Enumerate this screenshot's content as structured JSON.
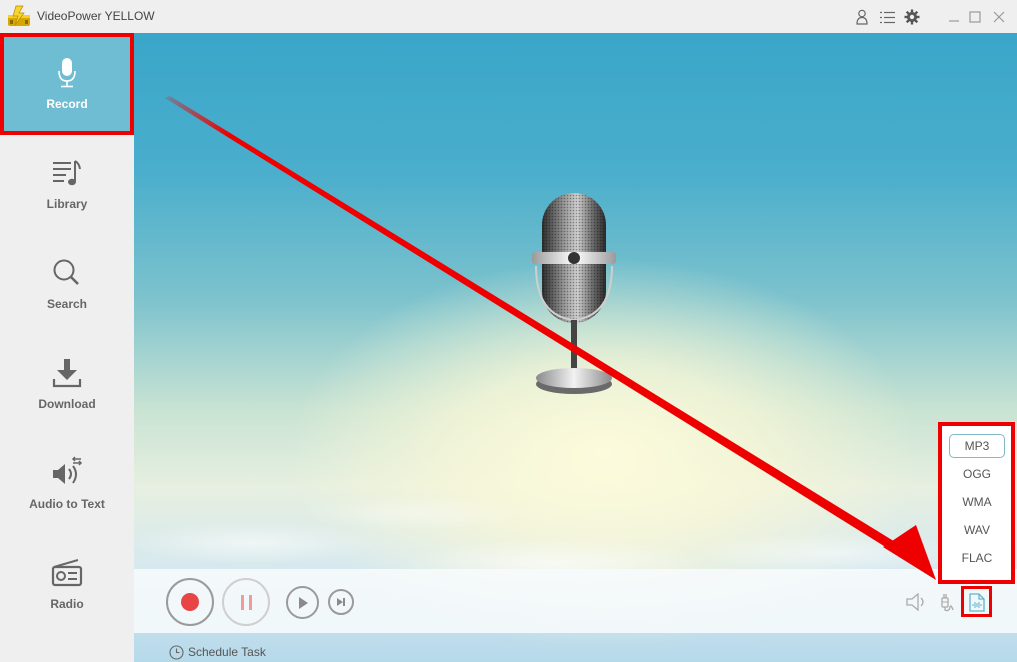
{
  "app": {
    "title": "VideoPower YELLOW"
  },
  "titlebar": {
    "icons": [
      "account-icon",
      "menu-list-icon",
      "settings-gear-icon",
      "minimize-icon",
      "maximize-icon",
      "close-icon"
    ]
  },
  "sidebar": {
    "items": [
      {
        "label": "Record",
        "icon": "microphone-icon",
        "active": true
      },
      {
        "label": "Library",
        "icon": "music-list-icon",
        "active": false
      },
      {
        "label": "Search",
        "icon": "search-icon",
        "active": false
      },
      {
        "label": "Download",
        "icon": "download-icon",
        "active": false
      },
      {
        "label": "Audio to Text",
        "icon": "speaker-convert-icon",
        "active": false
      },
      {
        "label": "Radio",
        "icon": "radio-icon",
        "active": false
      }
    ]
  },
  "controls": {
    "record": "record-icon",
    "pause": "pause-icon",
    "play": "play-icon",
    "next": "skip-next-icon",
    "right_icons": [
      "volume-icon",
      "audio-source-plug-icon",
      "audio-format-icon"
    ]
  },
  "schedule": {
    "label": "Schedule Task"
  },
  "format_menu": {
    "selected": "MP3",
    "options": [
      "MP3",
      "OGG",
      "WMA",
      "WAV",
      "FLAC"
    ]
  },
  "colors": {
    "accent": "#6ebdd2",
    "highlight": "#ee0000",
    "record_red": "#e84545"
  }
}
